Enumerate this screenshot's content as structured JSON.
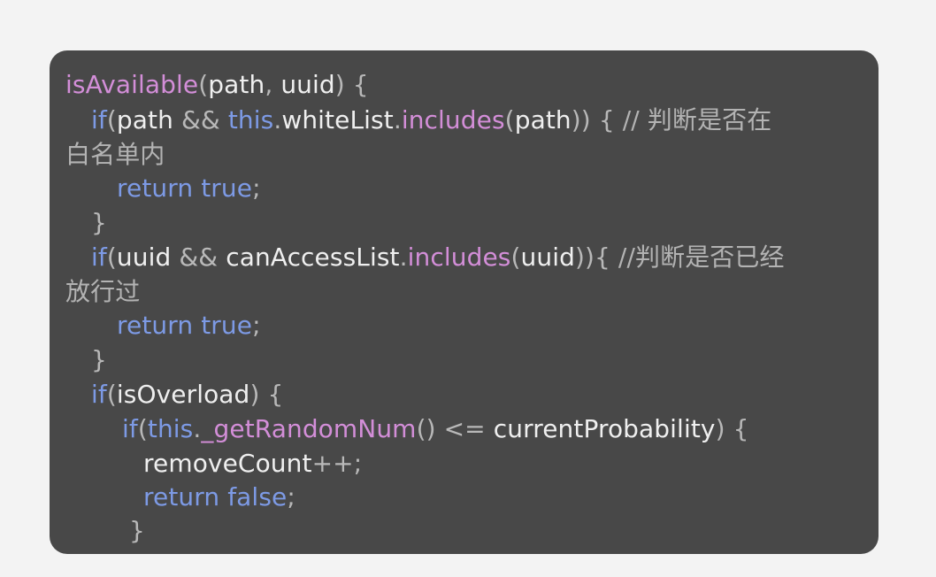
{
  "code_snippet": {
    "lines": [
      {
        "segments": [
          "isAvailable",
          "(",
          "path",
          ",",
          " uuid",
          ") {"
        ]
      },
      {
        "segments": [
          "if",
          "(",
          "path ",
          "&&",
          " this",
          ".",
          "whiteList",
          ".",
          "includes",
          "(",
          "path",
          ")) {",
          "  //  判断是否在"
        ]
      },
      {
        "segments": [
          "白名单内"
        ]
      },
      {
        "segments": [
          "return",
          " true",
          ";"
        ]
      },
      {
        "segments": [
          "}"
        ]
      },
      {
        "segments": [
          "if",
          "(",
          "uuid ",
          "&&",
          " canAccessList",
          ".",
          "includes",
          "(",
          "uuid",
          ")){",
          " //判断是否已经"
        ]
      },
      {
        "segments": [
          "放行过"
        ]
      },
      {
        "segments": [
          "return",
          " true",
          ";"
        ]
      },
      {
        "segments": [
          "}"
        ]
      },
      {
        "segments": [
          "if",
          "(",
          "isOverload",
          ") {"
        ]
      },
      {
        "segments": [
          "if",
          "(",
          "this",
          ".",
          "_getRandomNum",
          "()",
          " <=",
          " currentProbability",
          ") {"
        ]
      },
      {
        "segments": [
          "removeCount",
          "++",
          ";"
        ]
      },
      {
        "segments": [
          "return",
          " false",
          ";"
        ]
      },
      {
        "segments": [
          "}"
        ]
      }
    ]
  }
}
